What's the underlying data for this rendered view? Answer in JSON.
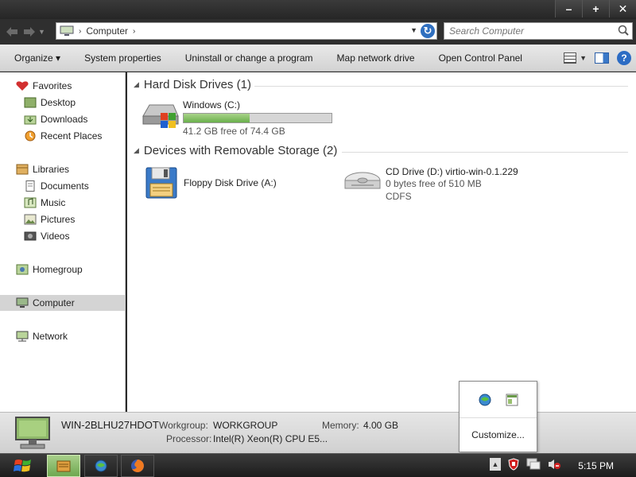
{
  "window": {
    "minimize_glyph": "–",
    "maximize_glyph": "+",
    "close_glyph": "✕"
  },
  "address": {
    "location": "Computer",
    "search_placeholder": "Search Computer"
  },
  "toolbar": {
    "items": [
      "Organize ▾",
      "System properties",
      "Uninstall or change a program",
      "Map network drive",
      "Open Control Panel"
    ]
  },
  "nav": {
    "favorites": "Favorites",
    "desktop": "Desktop",
    "downloads": "Downloads",
    "recent_places": "Recent Places",
    "libraries": "Libraries",
    "documents": "Documents",
    "music": "Music",
    "pictures": "Pictures",
    "videos": "Videos",
    "homegroup": "Homegroup",
    "computer": "Computer",
    "network": "Network"
  },
  "content": {
    "hdd_group": "Hard Disk Drives (1)",
    "removable_group": "Devices with Removable Storage (2)",
    "drive_c": {
      "name": "Windows (C:)",
      "free": "41.2 GB free of 74.4 GB",
      "used_fraction": 0.446
    },
    "floppy": {
      "name": "Floppy Disk Drive (A:)"
    },
    "cd": {
      "name": "CD Drive (D:) virtio-win-0.1.229",
      "free": "0 bytes free of 510 MB",
      "fs": "CDFS"
    }
  },
  "details": {
    "computer_name": "WIN-2BLHU27HDOT",
    "workgroup_label": "Workgroup:",
    "workgroup_value": "WORKGROUP",
    "memory_label": "Memory:",
    "memory_value": "4.00 GB",
    "processor_label": "Processor:",
    "processor_value": "Intel(R) Xeon(R) CPU E5..."
  },
  "popup": {
    "customize": "Customize..."
  },
  "taskbar": {
    "clock": "5:15 PM"
  },
  "colors": {
    "bar_fill": "#6ab04c",
    "selection": "#d4d4d4"
  }
}
